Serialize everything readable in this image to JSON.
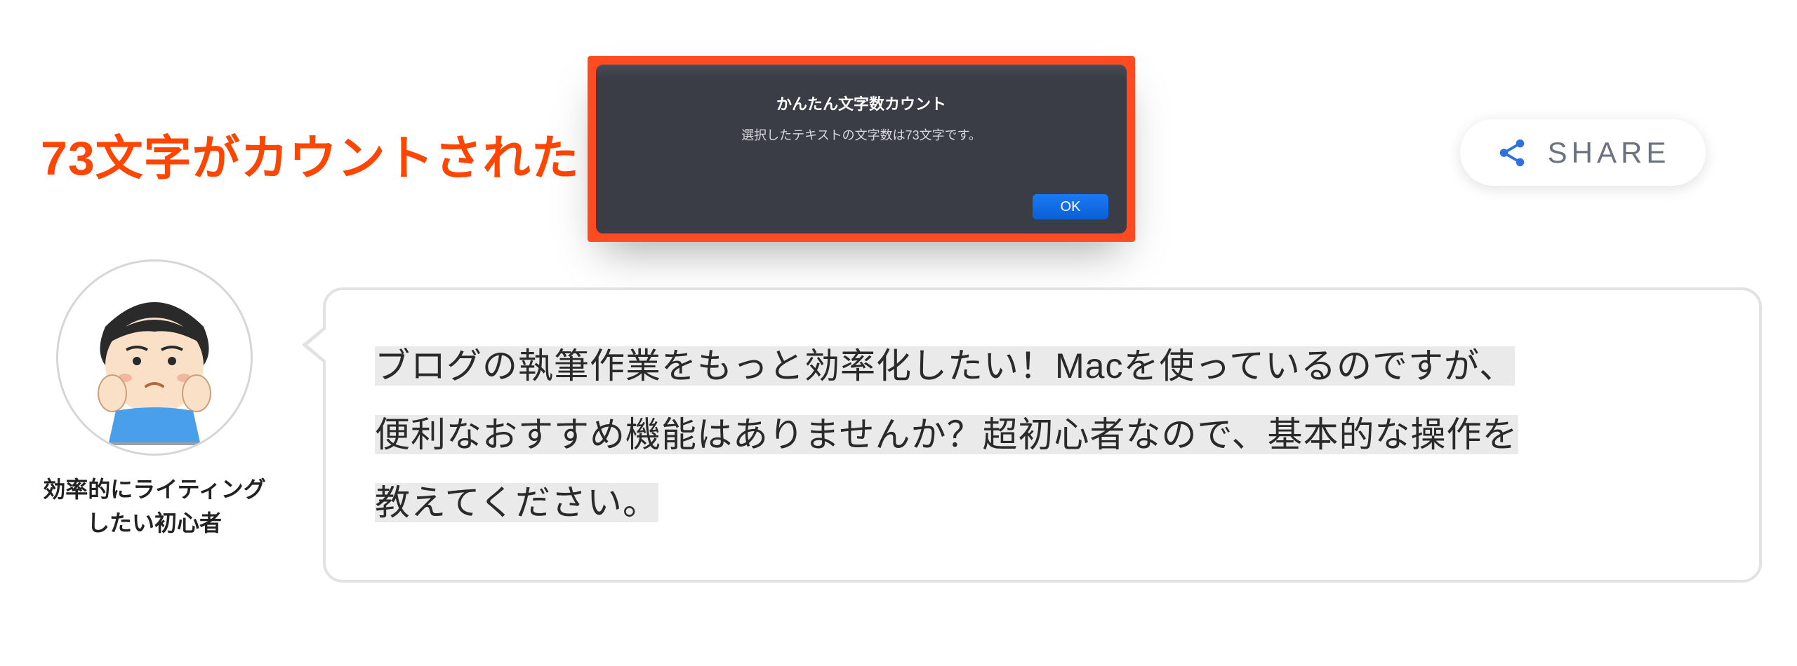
{
  "heading": "73文字がカウントされた",
  "dialog": {
    "title": "かんたん文字数カウント",
    "message": "選択したテキストの文字数は73文字です。",
    "ok_label": "OK"
  },
  "share": {
    "label": "SHARE",
    "icon": "share-icon"
  },
  "avatar": {
    "caption_line1": "効率的にライティング",
    "caption_line2": "したい初心者"
  },
  "bubble": {
    "text_highlighted_1": "ブログの執筆作業をもっと効率化したい！Macを使っているのですが、",
    "text_highlighted_2": "便利なおすすめ機能はありませんか？超初心者なので、基本的な操作を",
    "text_highlighted_3": "教えてください。"
  },
  "colors": {
    "accent_orange": "#ff4500",
    "dialog_bg": "#3a3c46",
    "ok_button": "#1b7af5",
    "highlight": "#eaeaea"
  }
}
